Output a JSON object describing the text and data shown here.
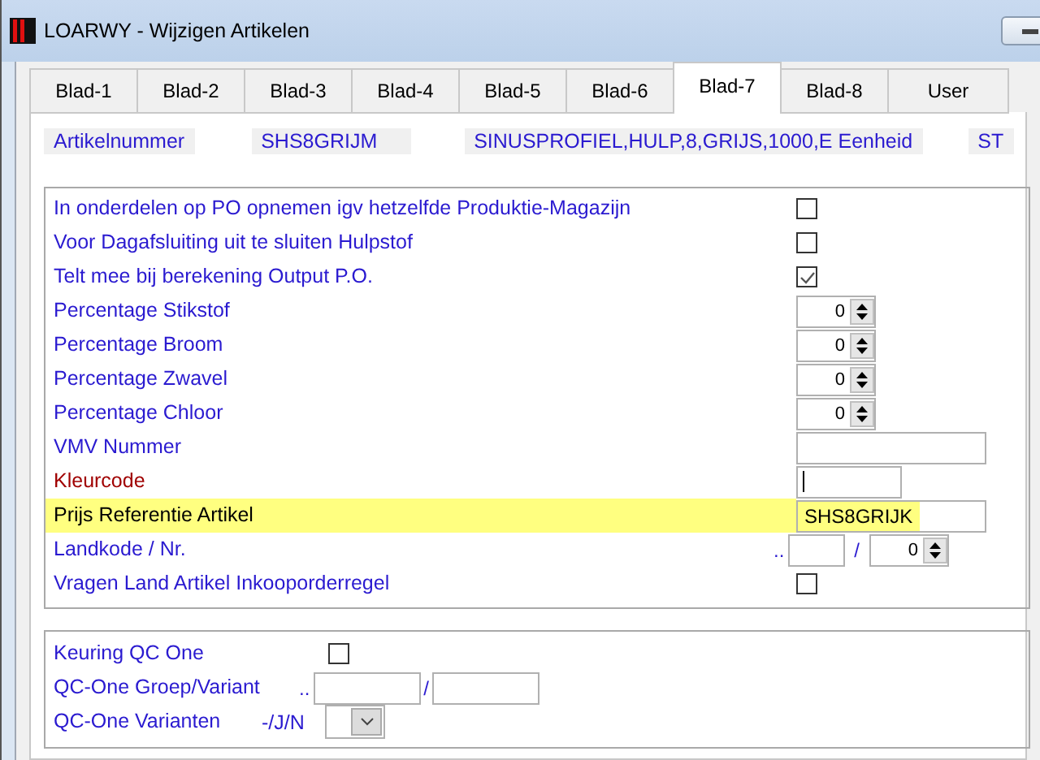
{
  "window": {
    "title": "LOARWY - Wijzigen Artikelen"
  },
  "tabs": [
    {
      "label": "Blad-1",
      "selected": false
    },
    {
      "label": "Blad-2",
      "selected": false
    },
    {
      "label": "Blad-3",
      "selected": false
    },
    {
      "label": "Blad-4",
      "selected": false
    },
    {
      "label": "Blad-5",
      "selected": false
    },
    {
      "label": "Blad-6",
      "selected": false
    },
    {
      "label": "Blad-7",
      "selected": true
    },
    {
      "label": "Blad-8",
      "selected": false
    },
    {
      "label": "User",
      "selected": false
    }
  ],
  "header": {
    "label": "Artikelnummer",
    "article_number": "SHS8GRIJM",
    "description": "SINUSPROFIEL,HULP,8,GRIJS,1000,E Eenheid",
    "unit": "ST"
  },
  "fields": [
    {
      "label": "In onderdelen op PO opnemen igv hetzelfde Produktie-Magazijn",
      "kind": "checkbox",
      "checked": false,
      "focused": false,
      "highlighted": false
    },
    {
      "label": "Voor Dagafsluiting uit te sluiten Hulpstof",
      "kind": "checkbox",
      "checked": false,
      "focused": false,
      "highlighted": false
    },
    {
      "label": "Telt mee bij berekening Output P.O.",
      "kind": "checkbox",
      "checked": true,
      "focused": false,
      "highlighted": false
    },
    {
      "label": "Percentage Stikstof",
      "kind": "spinner",
      "value": "0",
      "focused": false,
      "highlighted": false
    },
    {
      "label": "Percentage Broom",
      "kind": "spinner",
      "value": "0",
      "focused": false,
      "highlighted": false
    },
    {
      "label": "Percentage Zwavel",
      "kind": "spinner",
      "value": "0",
      "focused": false,
      "highlighted": false
    },
    {
      "label": "Percentage Chloor",
      "kind": "spinner",
      "value": "0",
      "focused": false,
      "highlighted": false
    },
    {
      "label": "VMV Nummer",
      "kind": "text",
      "focused": false,
      "highlighted": false
    },
    {
      "label": "Kleurcode",
      "kind": "short",
      "focused": true,
      "highlighted": false
    },
    {
      "label": "Prijs Referentie Artikel",
      "kind": "text",
      "value": "SHS8GRIJK",
      "focused": false,
      "highlighted": true
    },
    {
      "label": "Landkode / Nr.",
      "kind": "country",
      "prefix": "..",
      "separator": "/",
      "value": "0",
      "focused": false,
      "highlighted": false
    },
    {
      "label": "Vragen Land Artikel Inkooporderregel",
      "kind": "checkbox",
      "checked": false,
      "focused": false,
      "highlighted": false
    }
  ],
  "qc": [
    {
      "label": "Keuring QC One",
      "kind": "checkbox",
      "checked": false
    },
    {
      "label": "QC-One Groep/Variant",
      "kind": "pair",
      "prefix": "..",
      "separator": "/"
    },
    {
      "label": "QC-One Varianten",
      "kind": "select",
      "hint": "-/J/N"
    }
  ]
}
